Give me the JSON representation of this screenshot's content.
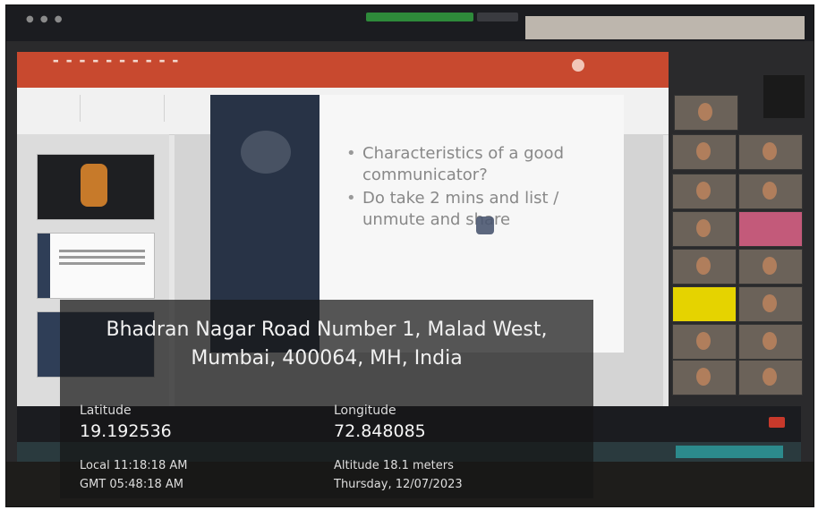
{
  "slide": {
    "bullets": [
      "Characteristics of a good communicator?",
      "Do take 2 mins and list / unmute and share"
    ]
  },
  "geotag": {
    "address_line1": "Bhadran Nagar Road Number 1, Malad West,",
    "address_line2": "Mumbai, 400064, MH, India",
    "latitude_label": "Latitude",
    "latitude": "19.192536",
    "longitude_label": "Longitude",
    "longitude": "72.848085",
    "local_time": "Local 11:18:18 AM",
    "gmt_time": "GMT 05:48:18 AM",
    "altitude": "Altitude 18.1 meters",
    "date": "Thursday, 12/07/2023"
  },
  "colors": {
    "ppt_ribbon": "#c8492f",
    "overlay_bg": "#161616",
    "zoom_end_button": "#c8392b"
  },
  "icons": [
    "cursor-icon",
    "window-control-icon"
  ]
}
